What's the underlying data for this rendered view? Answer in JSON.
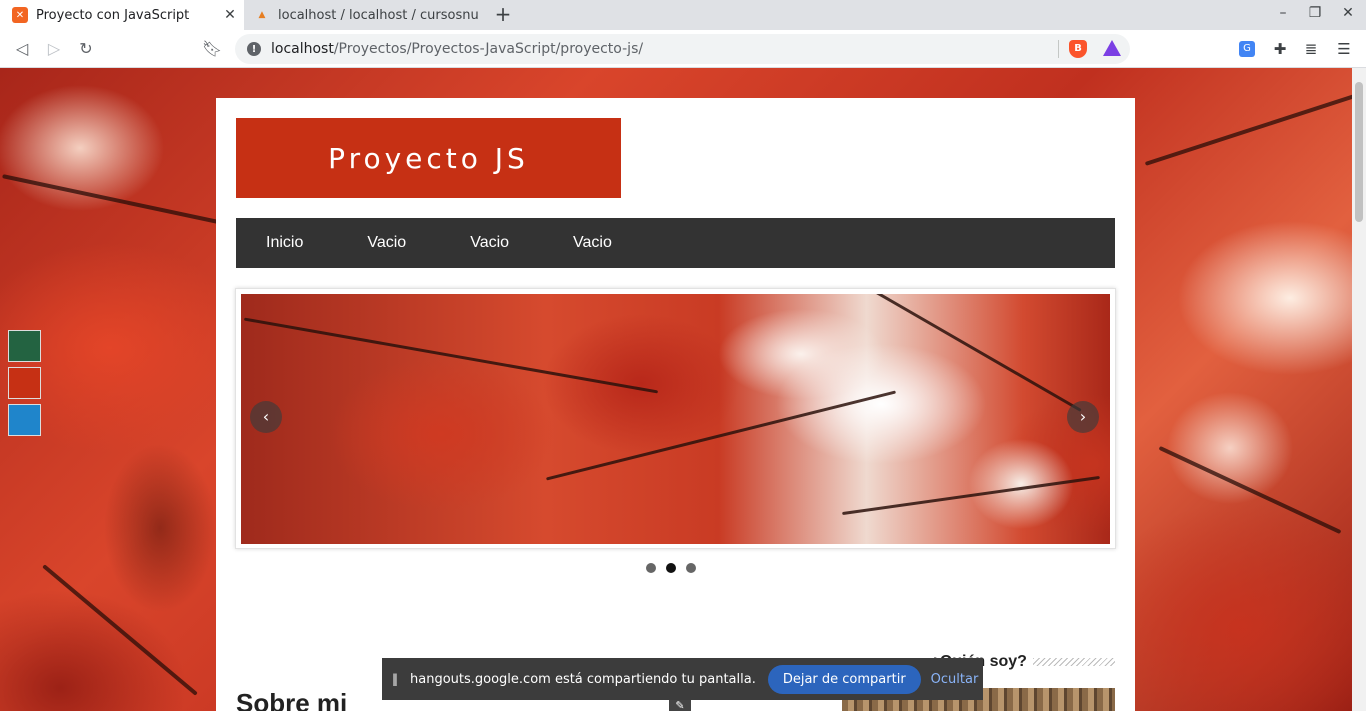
{
  "browser": {
    "tabs": [
      {
        "title": "Proyecto con JavaScript",
        "favicon": "xampp-icon",
        "active": true
      },
      {
        "title": "localhost / localhost / cursosnu",
        "favicon": "phpmyadmin-icon",
        "active": false
      }
    ],
    "new_tab": "+",
    "url_host": "localhost",
    "url_path": "/Proyectos/Proyectos-JavaScript/proyecto-js/"
  },
  "site": {
    "logo": "Proyecto JS",
    "menu": [
      "Inicio",
      "Vacio",
      "Vacio",
      "Vacio"
    ],
    "slider": {
      "active_dot": 2,
      "dots": 3
    },
    "sidebar_heading": "¿Quién soy?",
    "about_title": "Sobre mi",
    "theme_colors": [
      "#236341",
      "#c63014",
      "#1f85cb"
    ],
    "brand_color": "#c63014"
  },
  "share_notice": {
    "text": "hangouts.google.com está compartiendo tu pantalla.",
    "stop_label": "Dejar de compartir",
    "hide_label": "Ocultar"
  }
}
